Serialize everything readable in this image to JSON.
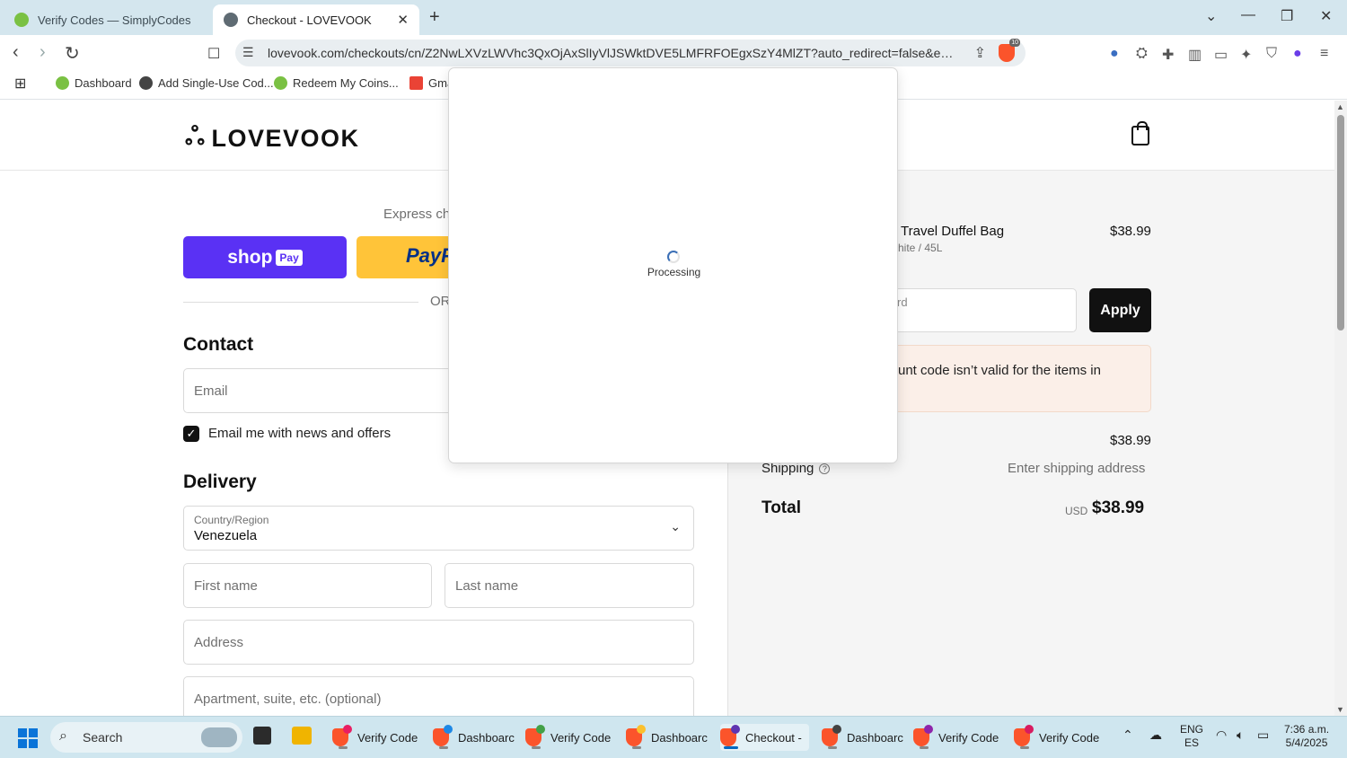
{
  "browser": {
    "tabs": [
      {
        "title": "Verify Codes — SimplyCodes",
        "active": false
      },
      {
        "title": "Checkout - LOVEVOOK",
        "active": true
      }
    ],
    "url": "lovevook.com/checkouts/cn/Z2NwLXVzLWVhc3QxOjAxSlIyVlJSWktDVE5LMFRFOEgxSzY4MlZT?auto_redirect=false&edge_redir...",
    "bookmarks": [
      "Dashboard",
      "Add Single-Use Cod...",
      "Redeem My Coins...",
      "Gma"
    ],
    "shield_badge": "10",
    "ext_badge": "1"
  },
  "store": {
    "logo_text": "LOVEVOOK"
  },
  "checkout": {
    "express_checkout": "Express ch",
    "shop_pay_label": "shop",
    "shop_pay_badge": "Pay",
    "paypal_label": "PayP",
    "or_text": "OR",
    "contact_heading": "Contact",
    "email_placeholder": "Email",
    "newsletter_label": "Email me with news and offers",
    "newsletter_checked": true,
    "delivery_heading": "Delivery",
    "country_label": "Country/Region",
    "country_value": "Venezuela",
    "first_name_placeholder": "First name",
    "last_name_placeholder": "Last name",
    "address_placeholder": "Address",
    "apartment_placeholder": "Apartment, suite, etc. (optional)"
  },
  "summary": {
    "item_name": "Travel Duffel Bag",
    "item_variant": "hite / 45L",
    "item_price": "$38.99",
    "discount_placeholder": "rd",
    "apply_label": "Apply",
    "error_message": "unt code isn’t valid for the items in",
    "subtotal_value": "$38.99",
    "shipping_label": "Shipping",
    "shipping_value": "Enter shipping address",
    "total_label": "Total",
    "currency": "USD",
    "total_value": "$38.99"
  },
  "popup": {
    "status_text": "Processing"
  },
  "taskbar": {
    "search_label": "Search",
    "apps": [
      {
        "label": "Verify Code",
        "active": false
      },
      {
        "label": "Dashboarc",
        "active": false
      },
      {
        "label": "Verify Code",
        "active": false
      },
      {
        "label": "Dashboarc",
        "active": false
      },
      {
        "label": "Checkout -",
        "active": true
      },
      {
        "label": "Dashboarc",
        "active": false
      },
      {
        "label": "Verify Code",
        "active": false
      },
      {
        "label": "Verify Code",
        "active": false
      }
    ],
    "language_primary": "ENG",
    "language_secondary": "ES",
    "time": "7:36 a.m.",
    "date": "5/4/2025"
  },
  "colors": {
    "shop_pay": "#5a31f4",
    "paypal": "#ffc439",
    "apply_button": "#111111",
    "error_background": "#fbefe8",
    "brave": "#fb542b",
    "taskbar": "#cfe6ef"
  }
}
